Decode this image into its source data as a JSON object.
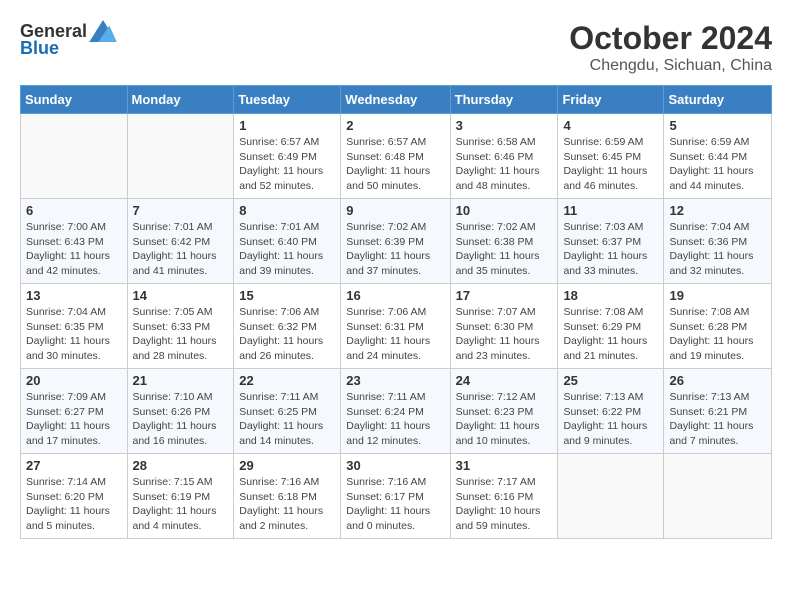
{
  "logo": {
    "text_general": "General",
    "text_blue": "Blue"
  },
  "title": "October 2024",
  "subtitle": "Chengdu, Sichuan, China",
  "days_of_week": [
    "Sunday",
    "Monday",
    "Tuesday",
    "Wednesday",
    "Thursday",
    "Friday",
    "Saturday"
  ],
  "weeks": [
    [
      {
        "day": "",
        "sunrise": "",
        "sunset": "",
        "daylight": ""
      },
      {
        "day": "",
        "sunrise": "",
        "sunset": "",
        "daylight": ""
      },
      {
        "day": "1",
        "sunrise": "Sunrise: 6:57 AM",
        "sunset": "Sunset: 6:49 PM",
        "daylight": "Daylight: 11 hours and 52 minutes."
      },
      {
        "day": "2",
        "sunrise": "Sunrise: 6:57 AM",
        "sunset": "Sunset: 6:48 PM",
        "daylight": "Daylight: 11 hours and 50 minutes."
      },
      {
        "day": "3",
        "sunrise": "Sunrise: 6:58 AM",
        "sunset": "Sunset: 6:46 PM",
        "daylight": "Daylight: 11 hours and 48 minutes."
      },
      {
        "day": "4",
        "sunrise": "Sunrise: 6:59 AM",
        "sunset": "Sunset: 6:45 PM",
        "daylight": "Daylight: 11 hours and 46 minutes."
      },
      {
        "day": "5",
        "sunrise": "Sunrise: 6:59 AM",
        "sunset": "Sunset: 6:44 PM",
        "daylight": "Daylight: 11 hours and 44 minutes."
      }
    ],
    [
      {
        "day": "6",
        "sunrise": "Sunrise: 7:00 AM",
        "sunset": "Sunset: 6:43 PM",
        "daylight": "Daylight: 11 hours and 42 minutes."
      },
      {
        "day": "7",
        "sunrise": "Sunrise: 7:01 AM",
        "sunset": "Sunset: 6:42 PM",
        "daylight": "Daylight: 11 hours and 41 minutes."
      },
      {
        "day": "8",
        "sunrise": "Sunrise: 7:01 AM",
        "sunset": "Sunset: 6:40 PM",
        "daylight": "Daylight: 11 hours and 39 minutes."
      },
      {
        "day": "9",
        "sunrise": "Sunrise: 7:02 AM",
        "sunset": "Sunset: 6:39 PM",
        "daylight": "Daylight: 11 hours and 37 minutes."
      },
      {
        "day": "10",
        "sunrise": "Sunrise: 7:02 AM",
        "sunset": "Sunset: 6:38 PM",
        "daylight": "Daylight: 11 hours and 35 minutes."
      },
      {
        "day": "11",
        "sunrise": "Sunrise: 7:03 AM",
        "sunset": "Sunset: 6:37 PM",
        "daylight": "Daylight: 11 hours and 33 minutes."
      },
      {
        "day": "12",
        "sunrise": "Sunrise: 7:04 AM",
        "sunset": "Sunset: 6:36 PM",
        "daylight": "Daylight: 11 hours and 32 minutes."
      }
    ],
    [
      {
        "day": "13",
        "sunrise": "Sunrise: 7:04 AM",
        "sunset": "Sunset: 6:35 PM",
        "daylight": "Daylight: 11 hours and 30 minutes."
      },
      {
        "day": "14",
        "sunrise": "Sunrise: 7:05 AM",
        "sunset": "Sunset: 6:33 PM",
        "daylight": "Daylight: 11 hours and 28 minutes."
      },
      {
        "day": "15",
        "sunrise": "Sunrise: 7:06 AM",
        "sunset": "Sunset: 6:32 PM",
        "daylight": "Daylight: 11 hours and 26 minutes."
      },
      {
        "day": "16",
        "sunrise": "Sunrise: 7:06 AM",
        "sunset": "Sunset: 6:31 PM",
        "daylight": "Daylight: 11 hours and 24 minutes."
      },
      {
        "day": "17",
        "sunrise": "Sunrise: 7:07 AM",
        "sunset": "Sunset: 6:30 PM",
        "daylight": "Daylight: 11 hours and 23 minutes."
      },
      {
        "day": "18",
        "sunrise": "Sunrise: 7:08 AM",
        "sunset": "Sunset: 6:29 PM",
        "daylight": "Daylight: 11 hours and 21 minutes."
      },
      {
        "day": "19",
        "sunrise": "Sunrise: 7:08 AM",
        "sunset": "Sunset: 6:28 PM",
        "daylight": "Daylight: 11 hours and 19 minutes."
      }
    ],
    [
      {
        "day": "20",
        "sunrise": "Sunrise: 7:09 AM",
        "sunset": "Sunset: 6:27 PM",
        "daylight": "Daylight: 11 hours and 17 minutes."
      },
      {
        "day": "21",
        "sunrise": "Sunrise: 7:10 AM",
        "sunset": "Sunset: 6:26 PM",
        "daylight": "Daylight: 11 hours and 16 minutes."
      },
      {
        "day": "22",
        "sunrise": "Sunrise: 7:11 AM",
        "sunset": "Sunset: 6:25 PM",
        "daylight": "Daylight: 11 hours and 14 minutes."
      },
      {
        "day": "23",
        "sunrise": "Sunrise: 7:11 AM",
        "sunset": "Sunset: 6:24 PM",
        "daylight": "Daylight: 11 hours and 12 minutes."
      },
      {
        "day": "24",
        "sunrise": "Sunrise: 7:12 AM",
        "sunset": "Sunset: 6:23 PM",
        "daylight": "Daylight: 11 hours and 10 minutes."
      },
      {
        "day": "25",
        "sunrise": "Sunrise: 7:13 AM",
        "sunset": "Sunset: 6:22 PM",
        "daylight": "Daylight: 11 hours and 9 minutes."
      },
      {
        "day": "26",
        "sunrise": "Sunrise: 7:13 AM",
        "sunset": "Sunset: 6:21 PM",
        "daylight": "Daylight: 11 hours and 7 minutes."
      }
    ],
    [
      {
        "day": "27",
        "sunrise": "Sunrise: 7:14 AM",
        "sunset": "Sunset: 6:20 PM",
        "daylight": "Daylight: 11 hours and 5 minutes."
      },
      {
        "day": "28",
        "sunrise": "Sunrise: 7:15 AM",
        "sunset": "Sunset: 6:19 PM",
        "daylight": "Daylight: 11 hours and 4 minutes."
      },
      {
        "day": "29",
        "sunrise": "Sunrise: 7:16 AM",
        "sunset": "Sunset: 6:18 PM",
        "daylight": "Daylight: 11 hours and 2 minutes."
      },
      {
        "day": "30",
        "sunrise": "Sunrise: 7:16 AM",
        "sunset": "Sunset: 6:17 PM",
        "daylight": "Daylight: 11 hours and 0 minutes."
      },
      {
        "day": "31",
        "sunrise": "Sunrise: 7:17 AM",
        "sunset": "Sunset: 6:16 PM",
        "daylight": "Daylight: 10 hours and 59 minutes."
      },
      {
        "day": "",
        "sunrise": "",
        "sunset": "",
        "daylight": ""
      },
      {
        "day": "",
        "sunrise": "",
        "sunset": "",
        "daylight": ""
      }
    ]
  ]
}
